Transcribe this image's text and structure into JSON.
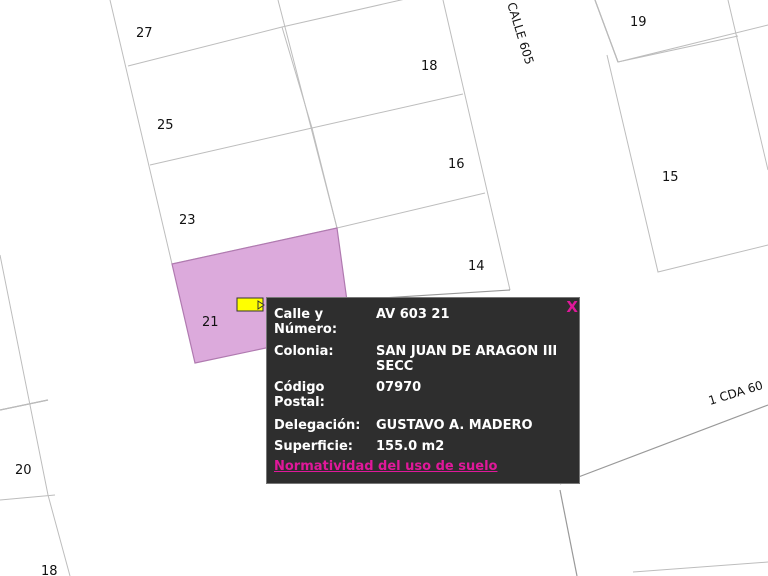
{
  "map": {
    "lots": [
      "27",
      "18",
      "25",
      "16",
      "23",
      "14",
      "21",
      "19",
      "15",
      "20",
      "18"
    ],
    "streets": [
      "CALLE 605",
      "1 CDA 60"
    ],
    "colors": {
      "selected_fill": "#dcaadc",
      "selected_stroke": "#b07ab0",
      "lot_stroke": "#bdbdbd",
      "road_stroke": "#999999"
    }
  },
  "marker": {
    "icon": "flag-icon",
    "color": "#ffff00"
  },
  "popup": {
    "close_label": "X",
    "fields": [
      {
        "label": "Calle y Número:",
        "value": "AV 603 21"
      },
      {
        "label": "Colonia:",
        "value": "SAN JUAN DE ARAGON III SECC"
      },
      {
        "label": "Código Postal:",
        "value": "07970"
      },
      {
        "label": "Delegación:",
        "value": "GUSTAVO A. MADERO"
      },
      {
        "label": "Superficie:",
        "value": "155.0 m2"
      }
    ],
    "link_label": "Normatividad del uso de suelo",
    "accent_color": "#e0189a"
  }
}
